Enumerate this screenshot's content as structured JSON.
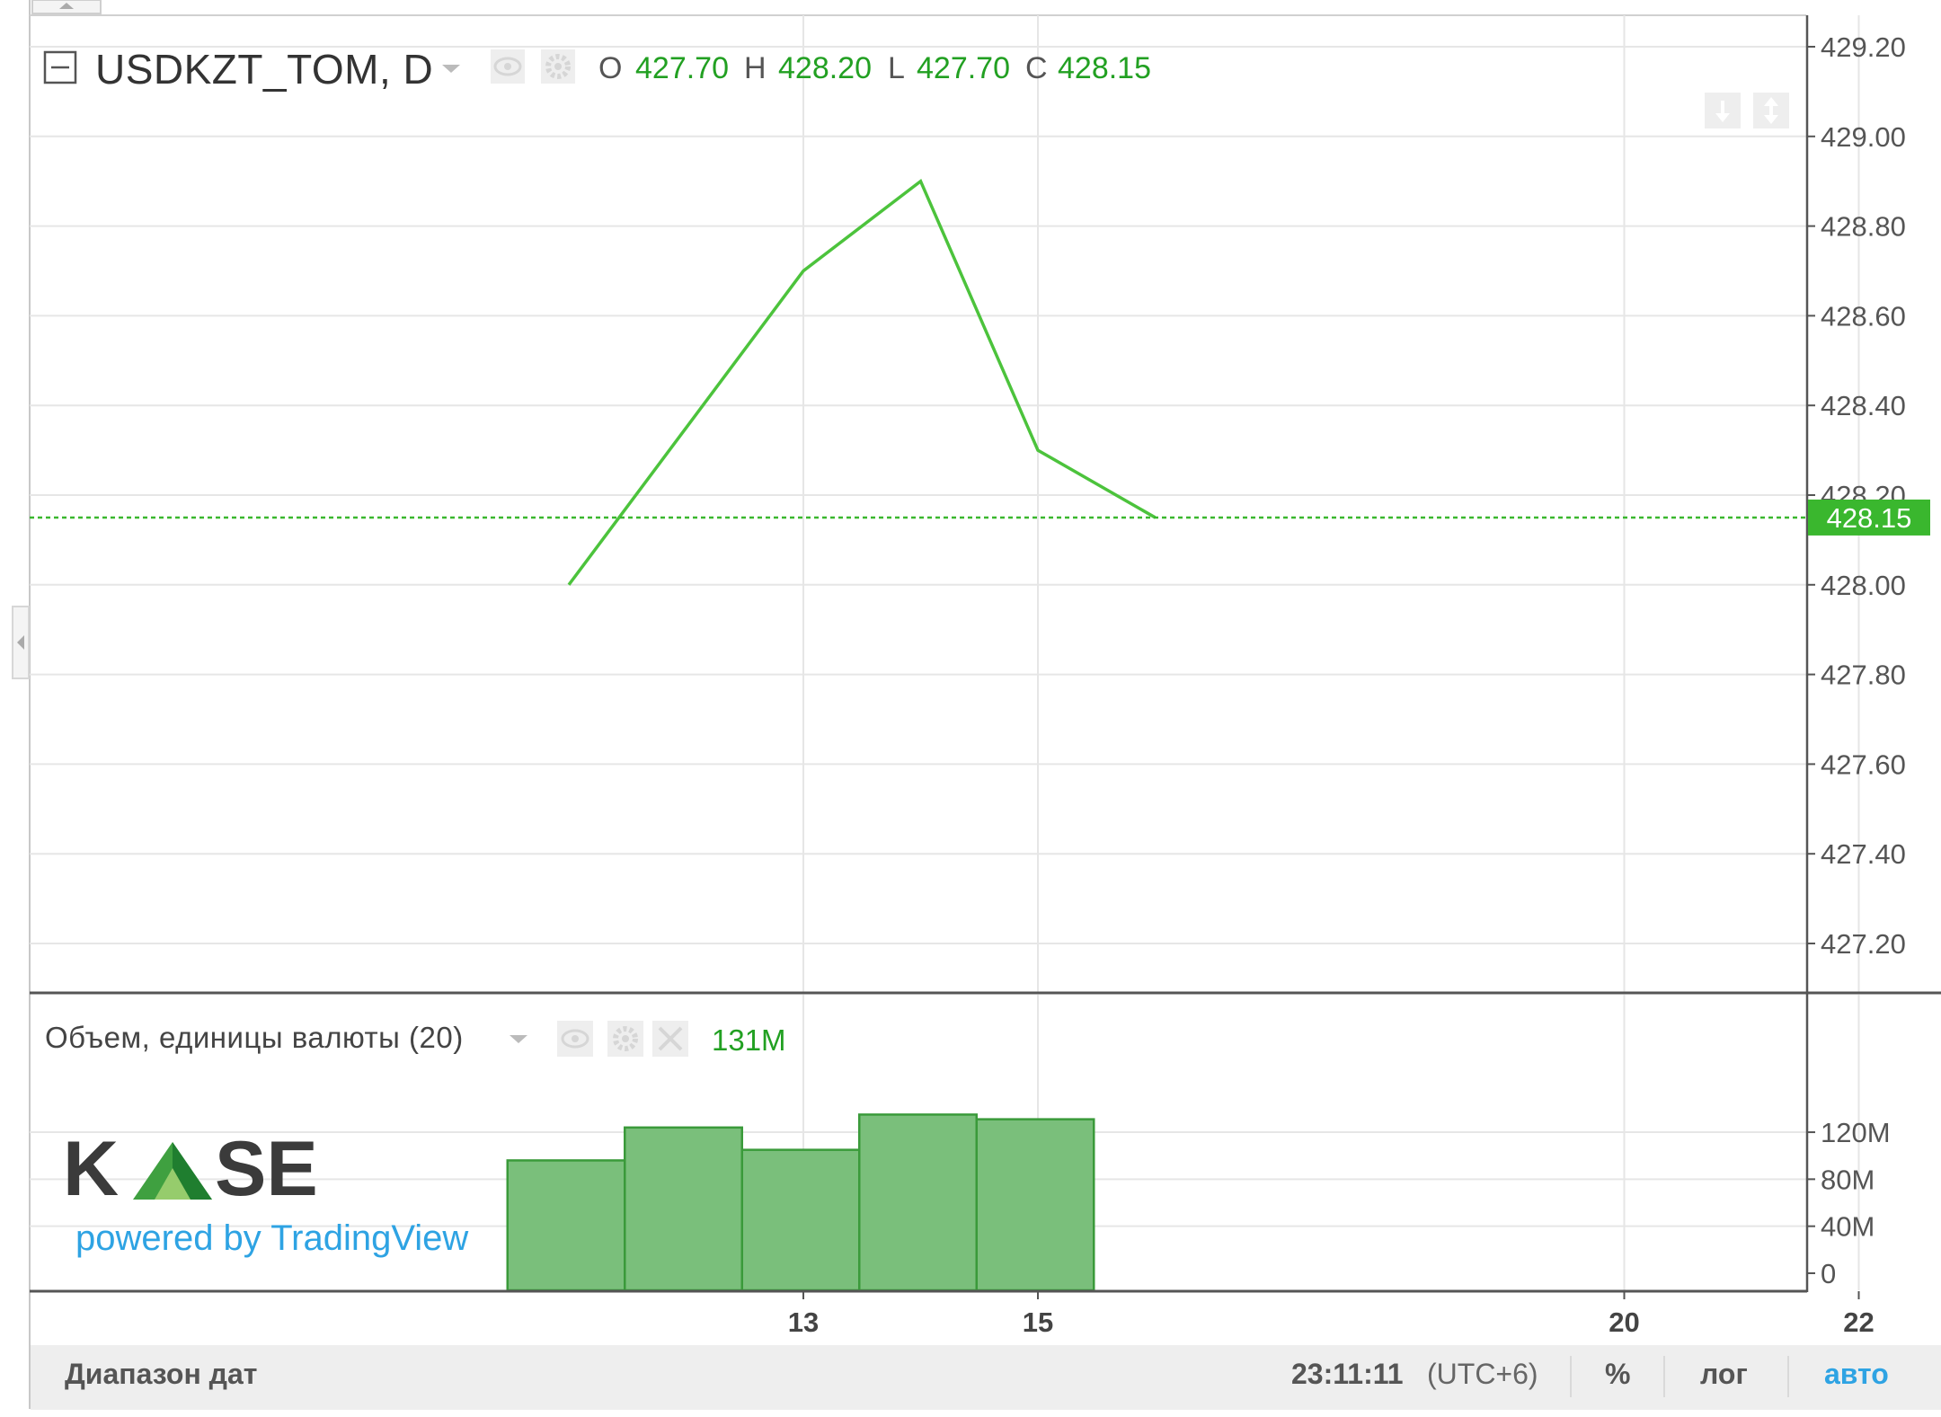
{
  "colors": {
    "line": "#4cc33c",
    "last_price_bg": "#3ab72e",
    "volume_fill": "#7abf7b",
    "volume_stroke": "#3a9a3a",
    "grid": "#e6e6e6",
    "footer_bg": "#eeeeee",
    "accent_blue": "#2ea3e3",
    "kase_dark": "#3b3b3b",
    "kase_green": "#3fa040"
  },
  "header": {
    "symbol": "USDKZT_TOM, D",
    "ohlc": [
      {
        "key": "O",
        "value": "427.70"
      },
      {
        "key": "H",
        "value": "428.20"
      },
      {
        "key": "L",
        "value": "427.70"
      },
      {
        "key": "C",
        "value": "428.15"
      }
    ],
    "icons": [
      "collapse-icon",
      "dropdown-caret-icon",
      "eye-icon",
      "gear-icon"
    ],
    "scale_buttons": [
      "arrow-down-icon",
      "arrows-updown-icon"
    ]
  },
  "volume_panel": {
    "title": "Объем, единицы валюты (20)",
    "last_value_label": "131M",
    "icons": [
      "dropdown-caret-icon",
      "eye-icon",
      "gear-icon",
      "close-icon"
    ]
  },
  "branding": {
    "logo_text": "KASE",
    "powered_by": "powered by TradingView"
  },
  "footer": {
    "date_range": "Диапазон дат",
    "time": "23:11:11",
    "timezone": "(UTC+6)",
    "percent": "%",
    "log": "лог",
    "auto": "авто"
  },
  "chart_data": [
    {
      "type": "line",
      "title": "USDKZT_TOM, D",
      "x_ticks": [
        "13",
        "15",
        "20",
        "22"
      ],
      "x": [
        "11",
        "13",
        "14",
        "15",
        "16"
      ],
      "series": [
        {
          "values": [
            428.0,
            428.7,
            428.9,
            428.3,
            428.15
          ]
        }
      ],
      "last_price": 428.15,
      "last_price_label": "428.15",
      "ylim": [
        427.08,
        429.24
      ],
      "y_ticks": [
        427.2,
        427.4,
        427.6,
        427.8,
        428.0,
        428.2,
        428.4,
        428.6,
        428.8,
        429.0,
        429.2
      ],
      "y_tick_labels": [
        "427.20",
        "427.40",
        "427.60",
        "427.80",
        "428.00",
        "428.20",
        "428.40",
        "428.60",
        "428.80",
        "429.00",
        "429.20"
      ],
      "grid": true
    },
    {
      "type": "bar",
      "title": "Объем, единицы валюты (20)",
      "x": [
        "11",
        "12",
        "13",
        "14",
        "15",
        "16"
      ],
      "values": [
        96,
        124,
        105,
        135,
        131
      ],
      "unit": "M",
      "ylim": [
        0,
        145
      ],
      "y_ticks": [
        0,
        40,
        80,
        120
      ],
      "y_tick_labels": [
        "0",
        "40M",
        "80M",
        "120M"
      ],
      "grid": true
    }
  ]
}
